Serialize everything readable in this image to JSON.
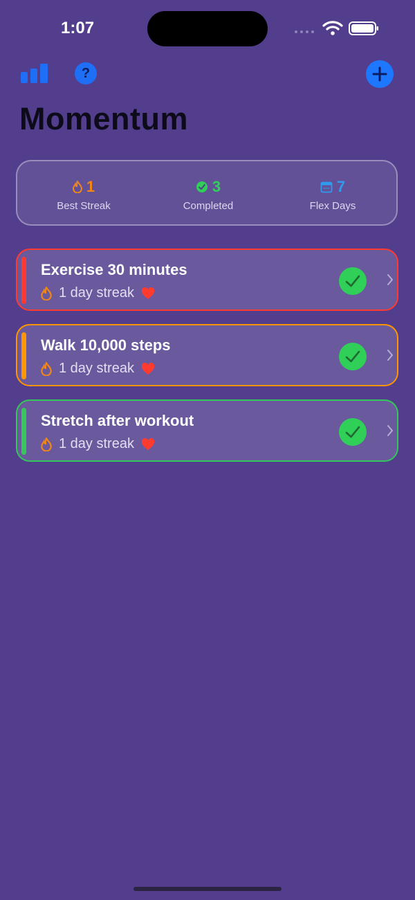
{
  "status_bar": {
    "time": "1:07"
  },
  "header": {
    "title": "Momentum"
  },
  "summary": {
    "best_streak": {
      "value": "1",
      "label": "Best Streak",
      "color": "#f0861a"
    },
    "completed": {
      "value": "3",
      "label": "Completed",
      "color": "#2fcf58"
    },
    "flex_days": {
      "value": "7",
      "label": "Flex Days",
      "color": "#2d9cf0"
    }
  },
  "habits": [
    {
      "name": "Exercise 30 minutes",
      "streak": "1 day streak",
      "accent": "#ff3b30"
    },
    {
      "name": "Walk 10,000 steps",
      "streak": "1 day streak",
      "accent": "#ff9500"
    },
    {
      "name": "Stretch after workout",
      "streak": "1 day streak",
      "accent": "#34c759"
    }
  ],
  "icons": {
    "toolbar": [
      "bar-chart-icon",
      "help-icon",
      "plus-icon"
    ],
    "habit": [
      "flame-icon",
      "heart-icon",
      "checkmark-icon",
      "chevron-right-icon"
    ],
    "help_glyph": "?"
  }
}
